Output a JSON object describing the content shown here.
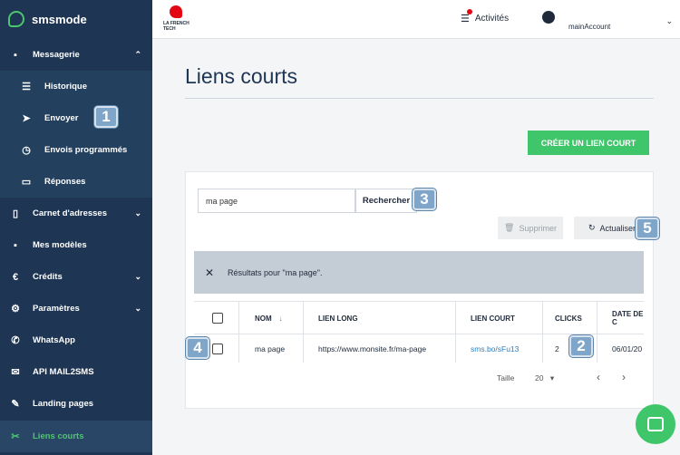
{
  "brand": {
    "name": "smsmode",
    "accent": "#4cc56f",
    "sidebar_bg": "#1e3553"
  },
  "sidebar": {
    "items": [
      {
        "label": "Messagerie",
        "icon": "chat-icon",
        "chevron": "⌃"
      },
      {
        "label": "Historique",
        "icon": "list-icon"
      },
      {
        "label": "Envoyer",
        "icon": "send-icon"
      },
      {
        "label": "Envois programmés",
        "icon": "clock-icon"
      },
      {
        "label": "Réponses",
        "icon": "inbox-icon"
      },
      {
        "label": "Carnet d'adresses",
        "icon": "address-book-icon",
        "chevron": "⌄"
      },
      {
        "label": "Mes modèles",
        "icon": "template-icon"
      },
      {
        "label": "Crédits",
        "icon": "euro-icon",
        "chevron": "⌄"
      },
      {
        "label": "Paramètres",
        "icon": "gear-icon",
        "chevron": "⌄"
      },
      {
        "label": "WhatsApp",
        "icon": "phone-icon"
      },
      {
        "label": "API MAIL2SMS",
        "icon": "mail-icon"
      },
      {
        "label": "Landing pages",
        "icon": "pencil-icon"
      },
      {
        "label": "Liens courts",
        "icon": "scissors-icon"
      }
    ]
  },
  "header": {
    "logo_text": "LA FRENCH TECH",
    "activities": "Activités",
    "account": "mainAccount"
  },
  "page": {
    "title": "Liens courts",
    "create_button": "CRÉER UN LIEN COURT",
    "search_value": "ma page",
    "search_button": "Rechercher",
    "delete_button": "Supprimer",
    "refresh_button": "Actualiser",
    "results_text": "Résultats pour \"ma page\"."
  },
  "table": {
    "headers": [
      "NOM",
      "LIEN LONG",
      "LIEN COURT",
      "CLICKS",
      "DATE DE C"
    ],
    "rows": [
      {
        "nom": "ma page",
        "lien_long": "https://www.monsite.fr/ma-page",
        "lien_court": "sms.bo/sFu13",
        "clicks": "2",
        "date": "06/01/20"
      }
    ]
  },
  "pager": {
    "label": "Taille",
    "size": "20"
  },
  "annotations": [
    "1",
    "2",
    "3",
    "4",
    "5"
  ]
}
